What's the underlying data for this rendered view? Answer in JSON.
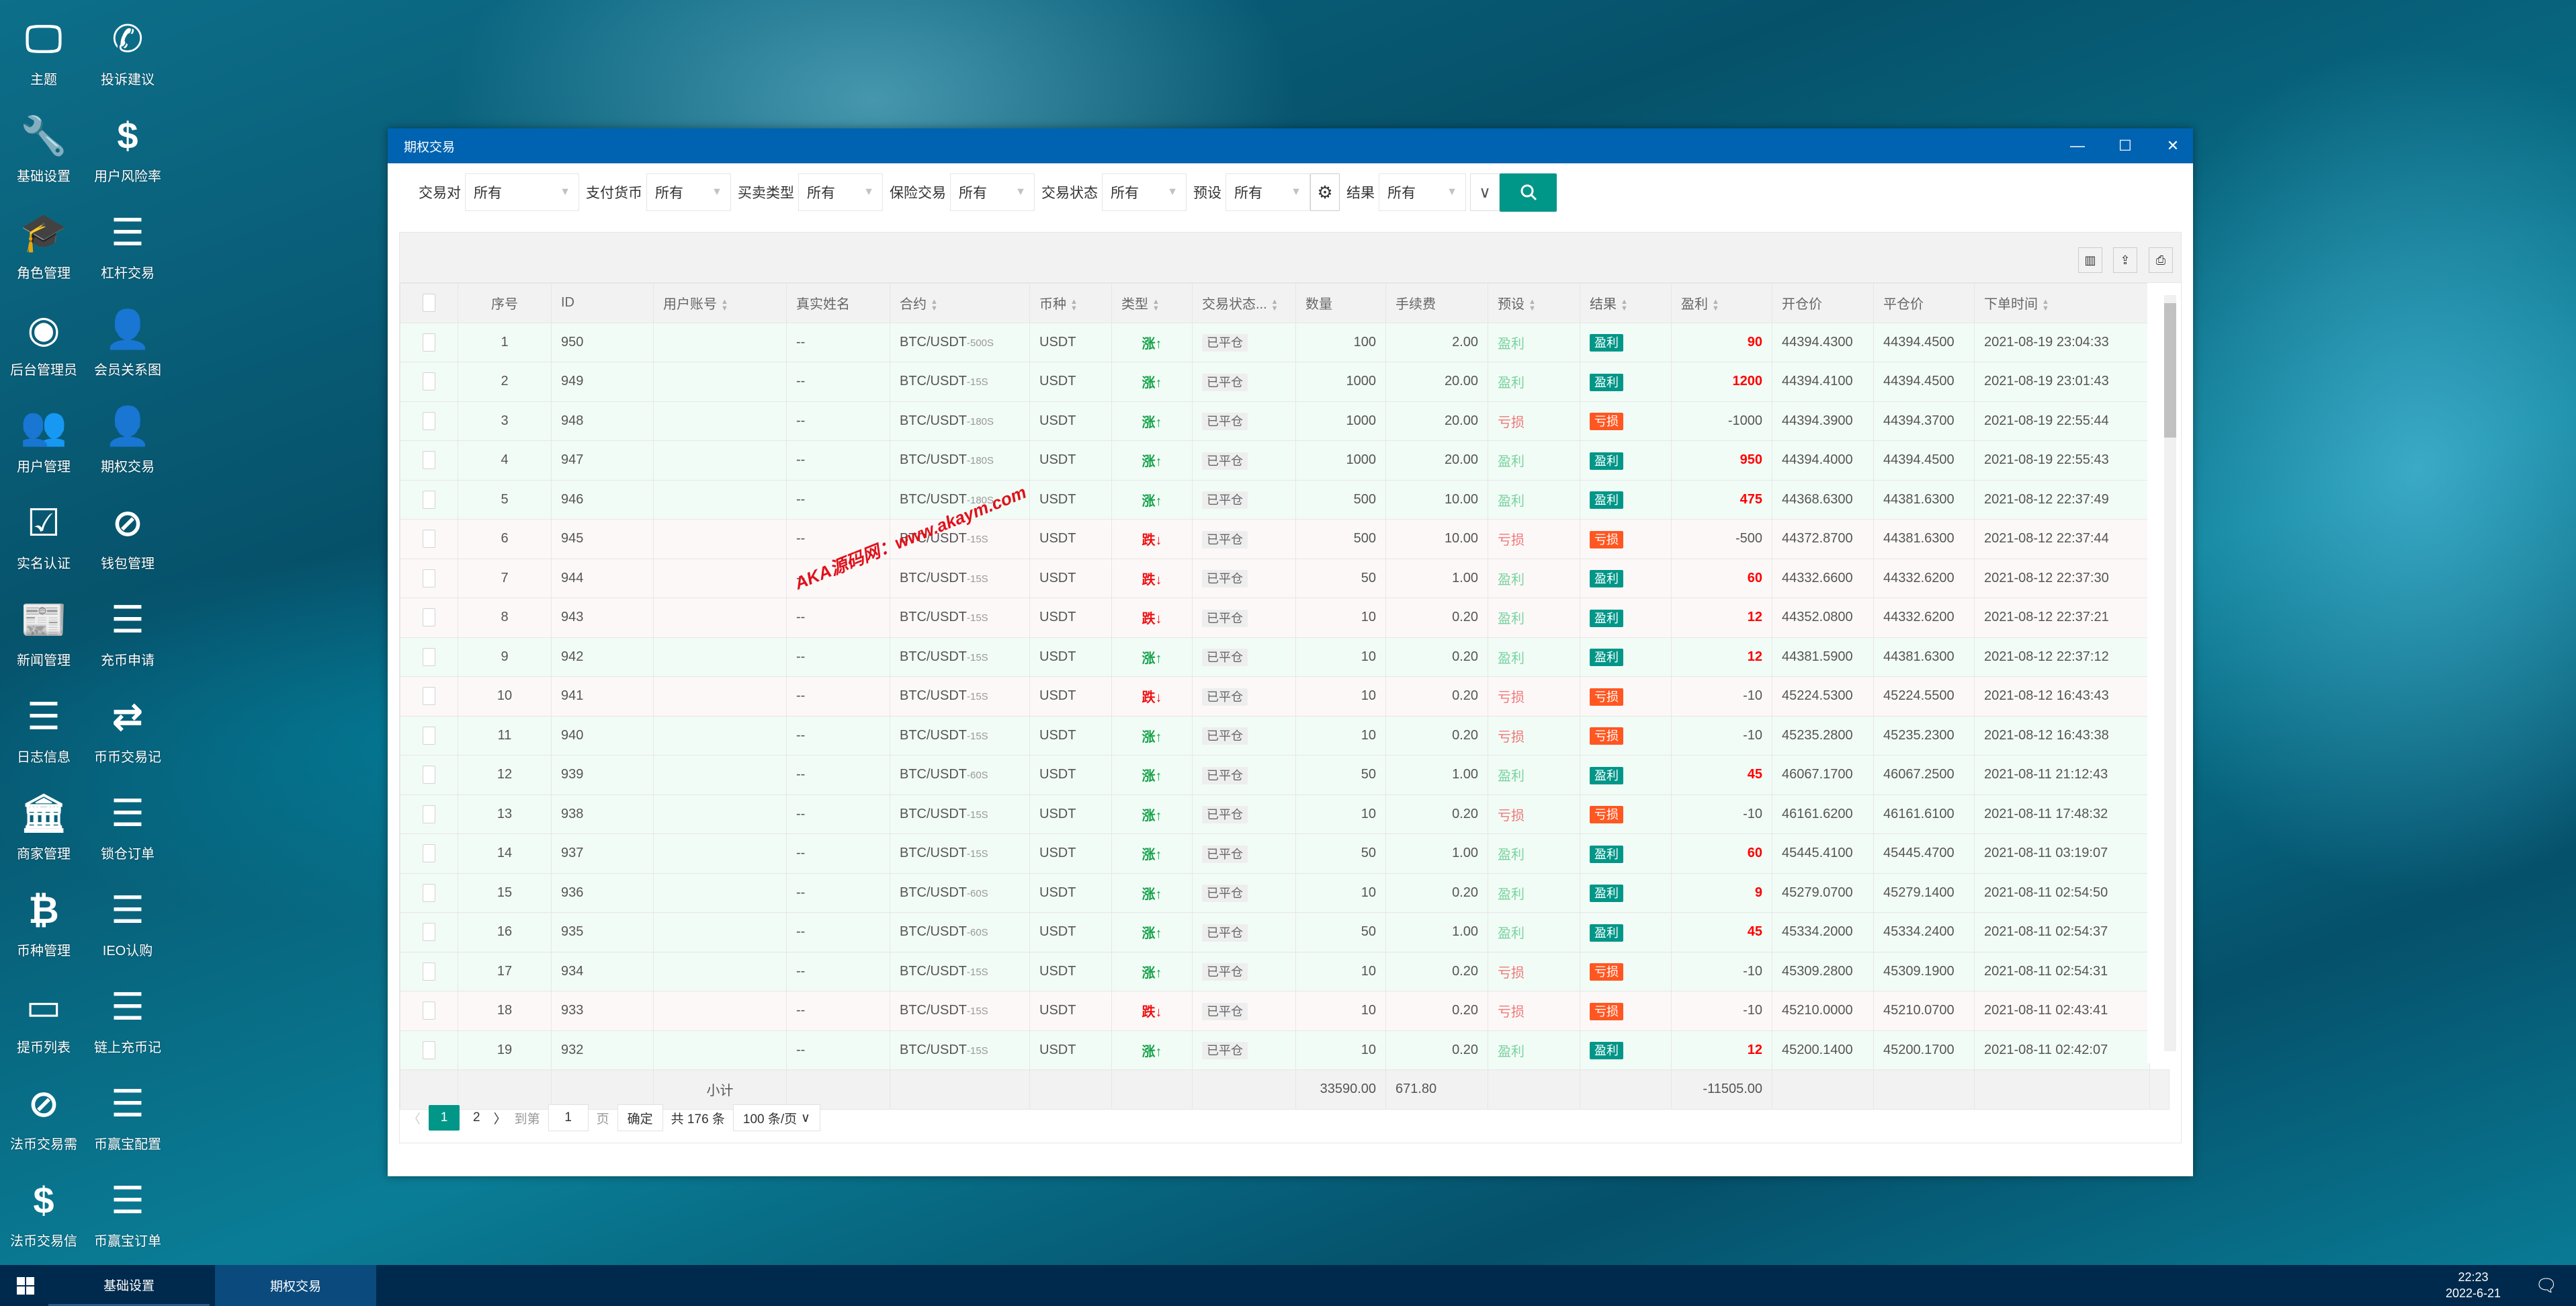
{
  "desktop": {
    "icons": [
      {
        "label": "主题",
        "icon": "monitor-icon"
      },
      {
        "label": "投诉建议",
        "icon": "phone-icon"
      },
      {
        "label": "基础设置",
        "icon": "wrench-icon"
      },
      {
        "label": "用户风险率",
        "icon": "dollar-icon"
      },
      {
        "label": "角色管理",
        "icon": "graduation-cap-icon"
      },
      {
        "label": "杠杆交易",
        "icon": "list-icon"
      },
      {
        "label": "后台管理员",
        "icon": "user-circle-icon"
      },
      {
        "label": "会员关系图",
        "icon": "user-plus-icon"
      },
      {
        "label": "用户管理",
        "icon": "users-icon"
      },
      {
        "label": "期权交易",
        "icon": "user-plus-icon"
      },
      {
        "label": "实名认证",
        "icon": "check-square-icon"
      },
      {
        "label": "钱包管理",
        "icon": "wallet-logo-icon"
      },
      {
        "label": "新闻管理",
        "icon": "newspaper-icon"
      },
      {
        "label": "充币申请",
        "icon": "list-icon"
      },
      {
        "label": "日志信息",
        "icon": "list-icon"
      },
      {
        "label": "币币交易记",
        "icon": "exchange-icon"
      },
      {
        "label": "商家管理",
        "icon": "bank-icon"
      },
      {
        "label": "锁仓订单",
        "icon": "list-icon"
      },
      {
        "label": "币种管理",
        "icon": "bitcoin-icon"
      },
      {
        "label": "IEO认购",
        "icon": "list-icon"
      },
      {
        "label": "提币列表",
        "icon": "credit-card-icon"
      },
      {
        "label": "链上充币记",
        "icon": "list-icon"
      },
      {
        "label": "法币交易需",
        "icon": "wallet-logo-icon"
      },
      {
        "label": "币赢宝配置",
        "icon": "list-icon"
      },
      {
        "label": "法币交易信",
        "icon": "dollar-icon"
      },
      {
        "label": "币赢宝订单",
        "icon": "list-icon"
      }
    ]
  },
  "window": {
    "title": "期权交易",
    "minimize": "—",
    "maximize": "☐",
    "close": "✕"
  },
  "filters": [
    {
      "label": "交易对",
      "value": "所有"
    },
    {
      "label": "支付货币",
      "value": "所有"
    },
    {
      "label": "买卖类型",
      "value": "所有"
    },
    {
      "label": "保险交易",
      "value": "所有"
    },
    {
      "label": "交易状态",
      "value": "所有"
    },
    {
      "label": "预设",
      "value": "所有"
    },
    {
      "label": "结果",
      "value": "所有"
    }
  ],
  "columns": [
    "序号",
    "ID",
    "用户账号",
    "真实姓名",
    "合约",
    "币种",
    "类型",
    "交易状态...",
    "数量",
    "手续费",
    "预设",
    "结果",
    "盈利",
    "开仓价",
    "平仓价",
    "下单时间"
  ],
  "rows": [
    {
      "no": "1",
      "id": "950",
      "contract": "BTC/USDT",
      "period": "-500S",
      "currency": "USDT",
      "type": "涨↑",
      "dir": "up",
      "status": "已平仓",
      "qty": "100",
      "fee": "2.00",
      "preset": "盈利",
      "result": "盈利",
      "profit": "90",
      "open": "44394.4300",
      "close": "44394.4500",
      "time": "2021-08-19 23:04:33"
    },
    {
      "no": "2",
      "id": "949",
      "contract": "BTC/USDT",
      "period": "-15S",
      "currency": "USDT",
      "type": "涨↑",
      "dir": "up",
      "status": "已平仓",
      "qty": "1000",
      "fee": "20.00",
      "preset": "盈利",
      "result": "盈利",
      "profit": "1200",
      "open": "44394.4100",
      "close": "44394.4500",
      "time": "2021-08-19 23:01:43"
    },
    {
      "no": "3",
      "id": "948",
      "contract": "BTC/USDT",
      "period": "-180S",
      "currency": "USDT",
      "type": "涨↑",
      "dir": "up",
      "status": "已平仓",
      "qty": "1000",
      "fee": "20.00",
      "preset": "亏损",
      "result": "亏损",
      "profit": "-1000",
      "open": "44394.3900",
      "close": "44394.3700",
      "time": "2021-08-19 22:55:44"
    },
    {
      "no": "4",
      "id": "947",
      "contract": "BTC/USDT",
      "period": "-180S",
      "currency": "USDT",
      "type": "涨↑",
      "dir": "up",
      "status": "已平仓",
      "qty": "1000",
      "fee": "20.00",
      "preset": "盈利",
      "result": "盈利",
      "profit": "950",
      "open": "44394.4000",
      "close": "44394.4500",
      "time": "2021-08-19 22:55:43"
    },
    {
      "no": "5",
      "id": "946",
      "contract": "BTC/USDT",
      "period": "-180S",
      "currency": "USDT",
      "type": "涨↑",
      "dir": "up",
      "status": "已平仓",
      "qty": "500",
      "fee": "10.00",
      "preset": "盈利",
      "result": "盈利",
      "profit": "475",
      "open": "44368.6300",
      "close": "44381.6300",
      "time": "2021-08-12 22:37:49"
    },
    {
      "no": "6",
      "id": "945",
      "contract": "BTC/USDT",
      "period": "-15S",
      "currency": "USDT",
      "type": "跌↓",
      "dir": "down",
      "status": "已平仓",
      "qty": "500",
      "fee": "10.00",
      "preset": "亏损",
      "result": "亏损",
      "profit": "-500",
      "open": "44372.8700",
      "close": "44381.6300",
      "time": "2021-08-12 22:37:44"
    },
    {
      "no": "7",
      "id": "944",
      "contract": "BTC/USDT",
      "period": "-15S",
      "currency": "USDT",
      "type": "跌↓",
      "dir": "down",
      "status": "已平仓",
      "qty": "50",
      "fee": "1.00",
      "preset": "盈利",
      "result": "盈利",
      "profit": "60",
      "open": "44332.6600",
      "close": "44332.6200",
      "time": "2021-08-12 22:37:30"
    },
    {
      "no": "8",
      "id": "943",
      "contract": "BTC/USDT",
      "period": "-15S",
      "currency": "USDT",
      "type": "跌↓",
      "dir": "down",
      "status": "已平仓",
      "qty": "10",
      "fee": "0.20",
      "preset": "盈利",
      "result": "盈利",
      "profit": "12",
      "open": "44352.0800",
      "close": "44332.6200",
      "time": "2021-08-12 22:37:21"
    },
    {
      "no": "9",
      "id": "942",
      "contract": "BTC/USDT",
      "period": "-15S",
      "currency": "USDT",
      "type": "涨↑",
      "dir": "up",
      "status": "已平仓",
      "qty": "10",
      "fee": "0.20",
      "preset": "盈利",
      "result": "盈利",
      "profit": "12",
      "open": "44381.5900",
      "close": "44381.6300",
      "time": "2021-08-12 22:37:12"
    },
    {
      "no": "10",
      "id": "941",
      "contract": "BTC/USDT",
      "period": "-15S",
      "currency": "USDT",
      "type": "跌↓",
      "dir": "down",
      "status": "已平仓",
      "qty": "10",
      "fee": "0.20",
      "preset": "亏损",
      "result": "亏损",
      "profit": "-10",
      "open": "45224.5300",
      "close": "45224.5500",
      "time": "2021-08-12 16:43:43"
    },
    {
      "no": "11",
      "id": "940",
      "contract": "BTC/USDT",
      "period": "-15S",
      "currency": "USDT",
      "type": "涨↑",
      "dir": "up",
      "status": "已平仓",
      "qty": "10",
      "fee": "0.20",
      "preset": "亏损",
      "result": "亏损",
      "profit": "-10",
      "open": "45235.2800",
      "close": "45235.2300",
      "time": "2021-08-12 16:43:38"
    },
    {
      "no": "12",
      "id": "939",
      "contract": "BTC/USDT",
      "period": "-60S",
      "currency": "USDT",
      "type": "涨↑",
      "dir": "up",
      "status": "已平仓",
      "qty": "50",
      "fee": "1.00",
      "preset": "盈利",
      "result": "盈利",
      "profit": "45",
      "open": "46067.1700",
      "close": "46067.2500",
      "time": "2021-08-11 21:12:43"
    },
    {
      "no": "13",
      "id": "938",
      "contract": "BTC/USDT",
      "period": "-15S",
      "currency": "USDT",
      "type": "涨↑",
      "dir": "up",
      "status": "已平仓",
      "qty": "10",
      "fee": "0.20",
      "preset": "亏损",
      "result": "亏损",
      "profit": "-10",
      "open": "46161.6200",
      "close": "46161.6100",
      "time": "2021-08-11 17:48:32"
    },
    {
      "no": "14",
      "id": "937",
      "contract": "BTC/USDT",
      "period": "-15S",
      "currency": "USDT",
      "type": "涨↑",
      "dir": "up",
      "status": "已平仓",
      "qty": "50",
      "fee": "1.00",
      "preset": "盈利",
      "result": "盈利",
      "profit": "60",
      "open": "45445.4100",
      "close": "45445.4700",
      "time": "2021-08-11 03:19:07"
    },
    {
      "no": "15",
      "id": "936",
      "contract": "BTC/USDT",
      "period": "-60S",
      "currency": "USDT",
      "type": "涨↑",
      "dir": "up",
      "status": "已平仓",
      "qty": "10",
      "fee": "0.20",
      "preset": "盈利",
      "result": "盈利",
      "profit": "9",
      "open": "45279.0700",
      "close": "45279.1400",
      "time": "2021-08-11 02:54:50"
    },
    {
      "no": "16",
      "id": "935",
      "contract": "BTC/USDT",
      "period": "-60S",
      "currency": "USDT",
      "type": "涨↑",
      "dir": "up",
      "status": "已平仓",
      "qty": "50",
      "fee": "1.00",
      "preset": "盈利",
      "result": "盈利",
      "profit": "45",
      "open": "45334.2000",
      "close": "45334.2400",
      "time": "2021-08-11 02:54:37"
    },
    {
      "no": "17",
      "id": "934",
      "contract": "BTC/USDT",
      "period": "-15S",
      "currency": "USDT",
      "type": "涨↑",
      "dir": "up",
      "status": "已平仓",
      "qty": "10",
      "fee": "0.20",
      "preset": "亏损",
      "result": "亏损",
      "profit": "-10",
      "open": "45309.2800",
      "close": "45309.1900",
      "time": "2021-08-11 02:54:31"
    },
    {
      "no": "18",
      "id": "933",
      "contract": "BTC/USDT",
      "period": "-15S",
      "currency": "USDT",
      "type": "跌↓",
      "dir": "down",
      "status": "已平仓",
      "qty": "10",
      "fee": "0.20",
      "preset": "亏损",
      "result": "亏损",
      "profit": "-10",
      "open": "45210.0000",
      "close": "45210.0700",
      "time": "2021-08-11 02:43:41"
    },
    {
      "no": "19",
      "id": "932",
      "contract": "BTC/USDT",
      "period": "-15S",
      "currency": "USDT",
      "type": "涨↑",
      "dir": "up",
      "status": "已平仓",
      "qty": "10",
      "fee": "0.20",
      "preset": "盈利",
      "result": "盈利",
      "profit": "12",
      "open": "45200.1400",
      "close": "45200.1700",
      "time": "2021-08-11 02:42:07"
    }
  ],
  "user_account_placeholder": "--",
  "subtotal": {
    "label": "小计",
    "qty": "33590.00",
    "fee": "671.80",
    "profit": "-11505.00"
  },
  "pager": {
    "prev": "〈",
    "pages": [
      "1",
      "2"
    ],
    "next": "〉",
    "goto": "到第",
    "page_value": "1",
    "page_unit": "页",
    "confirm": "确定",
    "total": "共 176 条",
    "page_size": "100 条/页"
  },
  "watermark": "AKA源码网：www.akaym.com",
  "taskbar": {
    "tasks": [
      "基础设置",
      "期权交易"
    ],
    "time": "22:23",
    "date": "2022-6-21"
  },
  "colors": {
    "titlebar": "#0063b1",
    "primary": "#009688",
    "loss": "#ff5722",
    "taskbar": "#002a4d"
  }
}
